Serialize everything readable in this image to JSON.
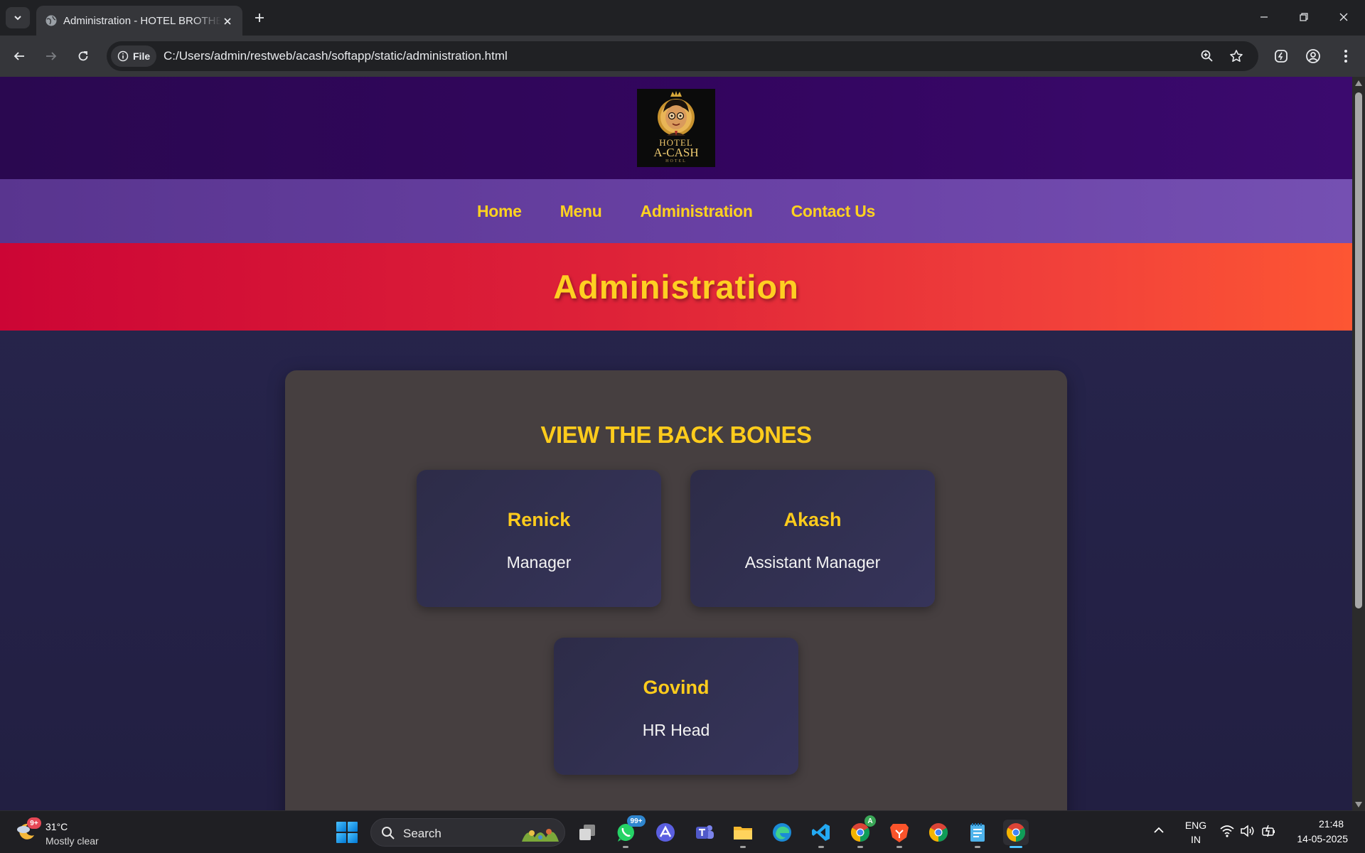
{
  "browser": {
    "tab_title": "Administration - HOTEL BROTHERS",
    "url": "C:/Users/admin/restweb/acash/softapp/static/administration.html",
    "site_chip_label": "File"
  },
  "site": {
    "logo": {
      "line1": "HOTEL",
      "line2": "A-CASH",
      "line3": "HOTEL"
    },
    "nav": [
      {
        "label": "Home"
      },
      {
        "label": "Menu"
      },
      {
        "label": "Administration"
      },
      {
        "label": "Contact Us"
      }
    ],
    "hero_title": "Administration",
    "section_title": "VIEW THE BACK BONES",
    "staff": [
      {
        "name": "Renick",
        "role": "Manager"
      },
      {
        "name": "Akash",
        "role": "Assistant Manager"
      },
      {
        "name": "Govind",
        "role": "HR Head"
      }
    ]
  },
  "taskbar": {
    "weather_badge": "9+",
    "weather_temp": "31°C",
    "weather_desc": "Mostly clear",
    "search_label": "Search",
    "whatsapp_badge": "99+",
    "chrome_badge": "A",
    "lang_line1": "ENG",
    "lang_line2": "IN",
    "time": "21:48",
    "date": "14-05-2025"
  },
  "colors": {
    "accent_yellow": "#ffcc1c",
    "nav_purple": "#6a42a6",
    "hero_red": "#de2238",
    "panel": "#463f40"
  }
}
